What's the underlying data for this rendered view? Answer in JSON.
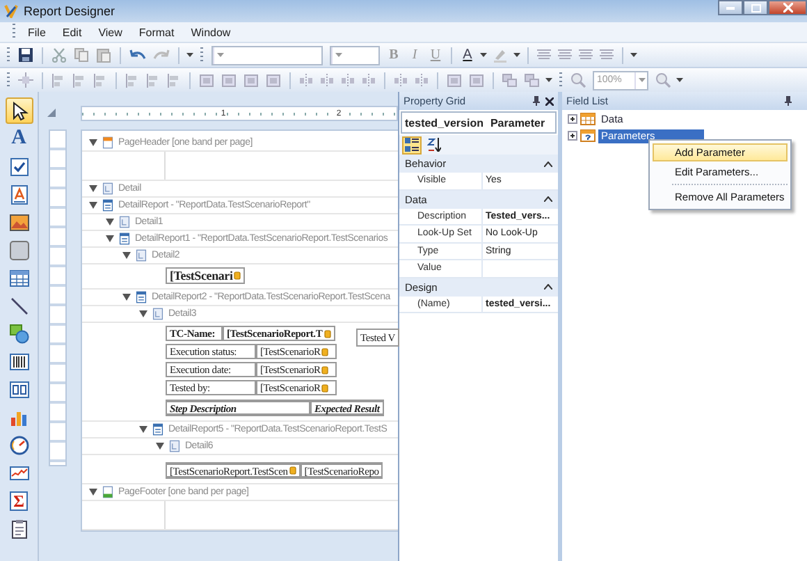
{
  "window": {
    "title": "Report Designer"
  },
  "menu": [
    "File",
    "Edit",
    "View",
    "Format",
    "Window"
  ],
  "toolbars": [
    [
      {
        "kind": "grip"
      },
      {
        "kind": "save"
      },
      {
        "kind": "sep"
      },
      {
        "kind": "cut"
      },
      {
        "kind": "copy"
      },
      {
        "kind": "paste"
      },
      {
        "kind": "sep"
      },
      {
        "kind": "undo"
      },
      {
        "kind": "redo"
      },
      {
        "kind": "sep"
      },
      {
        "kind": "dropdown"
      },
      {
        "kind": "grip"
      },
      {
        "kind": "font_name_combo"
      },
      {
        "kind": "font_size_combo"
      },
      {
        "kind": "bold",
        "text": "B"
      },
      {
        "kind": "italic",
        "text": "I"
      },
      {
        "kind": "underline",
        "text": "U"
      },
      {
        "kind": "sep"
      },
      {
        "kind": "font_color",
        "text": "A"
      },
      {
        "kind": "dropdown"
      },
      {
        "kind": "highlight"
      },
      {
        "kind": "dropdown"
      },
      {
        "kind": "sep"
      },
      {
        "kind": "align"
      },
      {
        "kind": "align"
      },
      {
        "kind": "align"
      },
      {
        "kind": "align"
      },
      {
        "kind": "sep"
      },
      {
        "kind": "dropdown"
      }
    ],
    [
      {
        "kind": "grip"
      },
      {
        "kind": "grid"
      },
      {
        "kind": "sep"
      },
      {
        "kind": "layout"
      },
      {
        "kind": "layout"
      },
      {
        "kind": "layout"
      },
      {
        "kind": "sep"
      },
      {
        "kind": "layout"
      },
      {
        "kind": "layout"
      },
      {
        "kind": "layout"
      },
      {
        "kind": "sep"
      },
      {
        "kind": "size"
      },
      {
        "kind": "size"
      },
      {
        "kind": "size"
      },
      {
        "kind": "size"
      },
      {
        "kind": "sep"
      },
      {
        "kind": "spacing"
      },
      {
        "kind": "spacing"
      },
      {
        "kind": "spacing"
      },
      {
        "kind": "spacing"
      },
      {
        "kind": "sep"
      },
      {
        "kind": "spacing"
      },
      {
        "kind": "spacing"
      },
      {
        "kind": "sep"
      },
      {
        "kind": "size"
      },
      {
        "kind": "size"
      },
      {
        "kind": "sep"
      },
      {
        "kind": "order"
      },
      {
        "kind": "order"
      },
      {
        "kind": "dropdown"
      },
      {
        "kind": "grip"
      },
      {
        "kind": "zoom"
      },
      {
        "kind": "zoom_combo",
        "text": "100%"
      },
      {
        "kind": "zoom"
      },
      {
        "kind": "dropdown"
      }
    ]
  ],
  "toolbox": [
    {
      "kind": "pointer",
      "selected": true
    },
    {
      "kind": "label",
      "glyph": "A",
      "selected": false
    },
    {
      "kind": "checkbox",
      "selected": false
    },
    {
      "kind": "richtext",
      "selected": false
    },
    {
      "kind": "picture",
      "selected": false
    },
    {
      "kind": "panel",
      "selected": false
    },
    {
      "kind": "table",
      "selected": false
    },
    {
      "kind": "line",
      "selected": false
    },
    {
      "kind": "shape",
      "selected": false
    },
    {
      "kind": "barcode",
      "selected": false
    },
    {
      "kind": "zipcode",
      "selected": false
    },
    {
      "kind": "chart",
      "selected": false
    },
    {
      "kind": "gauge",
      "selected": false
    },
    {
      "kind": "sparkline",
      "selected": false
    },
    {
      "kind": "summary",
      "glyph": "Σ",
      "selected": false
    },
    {
      "kind": "clipboard",
      "selected": false
    }
  ],
  "designer": {
    "ruler_labels": [
      "1",
      "2"
    ],
    "bands": [
      {
        "kind": "page_header",
        "label": "PageHeader [one band per page]",
        "content": {
          "kind": "empty"
        }
      },
      {
        "kind": "detail",
        "label": "Detail"
      },
      {
        "kind": "detail_report",
        "label": "DetailReport - \"ReportData.TestScenarioReport\"",
        "children": [
          {
            "kind": "detail",
            "label": "Detail1"
          },
          {
            "kind": "detail_report",
            "label": "DetailReport1 - \"ReportData.TestScenarioReport.TestScenarios",
            "children": [
              {
                "kind": "detail",
                "label": "Detail2",
                "content": {
                  "kind": "field",
                  "text": "[TestScenari"
                }
              },
              {
                "kind": "detail_report",
                "label": "DetailReport2 - \"ReportData.TestScenarioReport.TestScena",
                "children": [
                  {
                    "kind": "detail",
                    "label": "Detail3",
                    "content": {
                      "kind": "form",
                      "rows": [
                        {
                          "label": "TC-Name:",
                          "value": "[TestScenarioReport.T",
                          "bold": true
                        },
                        {
                          "label": "Execution status:",
                          "value": "[TestScenarioR",
                          "bold": false
                        },
                        {
                          "label": "Execution date:",
                          "value": "[TestScenarioR",
                          "bold": false
                        },
                        {
                          "label": "Tested by:",
                          "value": "[TestScenarioR",
                          "bold": false
                        }
                      ],
                      "side": "Tested V",
                      "header": [
                        "Step Description",
                        "Expected Result"
                      ]
                    }
                  },
                  {
                    "kind": "detail_report",
                    "label": "DetailReport5 - \"ReportData.TestScenarioReport.TestS",
                    "children": [
                      {
                        "kind": "detail",
                        "label": "Detail6",
                        "content": {
                          "kind": "cells",
                          "cells": [
                            "[TestScenarioReport.TestScen",
                            "[TestScenarioRepo"
                          ]
                        }
                      }
                    ]
                  }
                ]
              }
            ]
          }
        ]
      },
      {
        "kind": "page_footer",
        "label": "PageFooter [one band per page]",
        "content": {
          "kind": "empty"
        }
      }
    ]
  },
  "property_grid": {
    "title": "Property Grid",
    "object": "tested_version",
    "object_type": "Parameter",
    "toolbar": [
      {
        "kind": "categorized",
        "selected": true
      },
      {
        "kind": "alphabetical",
        "selected": false
      }
    ],
    "categories": [
      {
        "name": "Behavior",
        "expanded": true,
        "rows": [
          {
            "name": "Visible",
            "value": "Yes",
            "bold": false
          }
        ]
      },
      {
        "name": "Data",
        "expanded": true,
        "rows": [
          {
            "name": "Description",
            "value": "Tested_vers...",
            "bold": true
          },
          {
            "name": "Look-Up Set",
            "value": "No Look-Up",
            "bold": false
          },
          {
            "name": "Type",
            "value": "String",
            "bold": false
          },
          {
            "name": "Value",
            "bold": false
          }
        ]
      },
      {
        "name": "Design",
        "expanded": true,
        "rows": [
          {
            "name": "(Name)",
            "value": "tested_versi...",
            "bold": true
          }
        ]
      }
    ]
  },
  "field_list": {
    "title": "Field List",
    "items": [
      {
        "kind": "data",
        "label": "Data",
        "expanded": false,
        "selected": false
      },
      {
        "kind": "parameters",
        "label": "Parameters",
        "expanded": false,
        "selected": true
      }
    ]
  },
  "context_menu": {
    "items": [
      {
        "label": "Add Parameter",
        "selected": true,
        "separator": false
      },
      {
        "label": "Edit Parameters...",
        "selected": false,
        "separator": false
      },
      {
        "label": "Remove All Parameters",
        "selected": false,
        "separator": true
      }
    ]
  }
}
